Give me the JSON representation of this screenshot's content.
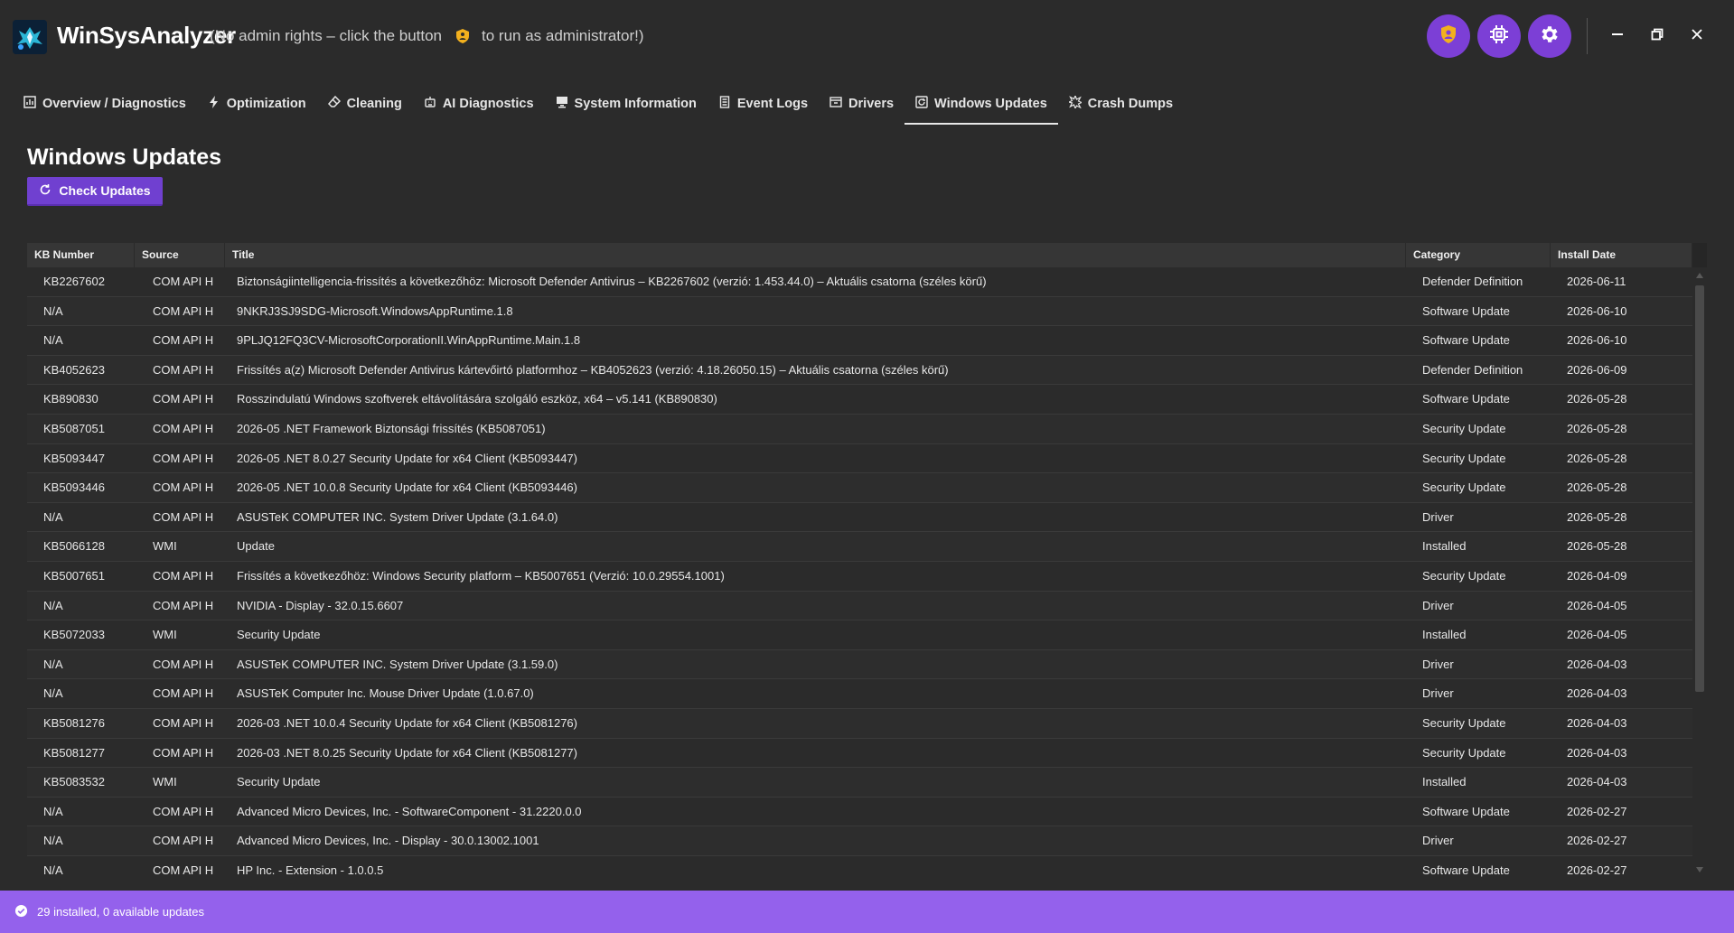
{
  "app": {
    "name": "WinSysAnalyzer",
    "admin_note_before": "(No admin rights – click the button",
    "admin_note_after": "to run as administrator!)"
  },
  "toolbar": {
    "admin_button_icon": "shield-icon",
    "chip_button_icon": "cpu-chip-icon",
    "settings_button_icon": "gear-icon",
    "accent_color": "#7c3fd6"
  },
  "tabs": [
    {
      "label": "Overview / Diagnostics",
      "icon": "bar-chart-icon"
    },
    {
      "label": "Optimization",
      "icon": "lightning-icon"
    },
    {
      "label": "Cleaning",
      "icon": "eraser-icon"
    },
    {
      "label": "AI Diagnostics",
      "icon": "robot-icon"
    },
    {
      "label": "System Information",
      "icon": "monitor-icon"
    },
    {
      "label": "Event Logs",
      "icon": "document-icon"
    },
    {
      "label": "Drivers",
      "icon": "package-icon"
    },
    {
      "label": "Windows Updates",
      "icon": "update-icon",
      "active": true
    },
    {
      "label": "Crash Dumps",
      "icon": "burst-icon"
    }
  ],
  "page": {
    "title": "Windows Updates",
    "check_button_label": "Check Updates"
  },
  "table": {
    "columns": [
      "KB Number",
      "Source",
      "Title",
      "Category",
      "Install Date"
    ],
    "rows": [
      [
        "KB2267602",
        "COM API H",
        "Biztonságiintelligencia-frissítés a következőhöz: Microsoft Defender Antivirus – KB2267602 (verzió: 1.453.44.0) – Aktuális csatorna (széles körű)",
        "Defender Definition",
        "2026-06-11"
      ],
      [
        "N/A",
        "COM API H",
        "9NKRJ3SJ9SDG-Microsoft.WindowsAppRuntime.1.8",
        "Software Update",
        "2026-06-10"
      ],
      [
        "N/A",
        "COM API H",
        "9PLJQ12FQ3CV-MicrosoftCorporationII.WinAppRuntime.Main.1.8",
        "Software Update",
        "2026-06-10"
      ],
      [
        "KB4052623",
        "COM API H",
        "Frissítés a(z) Microsoft Defender Antivirus kártevőirtó platformhoz – KB4052623 (verzió: 4.18.26050.15) – Aktuális csatorna (széles körű)",
        "Defender Definition",
        "2026-06-09"
      ],
      [
        "KB890830",
        "COM API H",
        "Rosszindulatú Windows szoftverek eltávolítására szolgáló eszköz, x64 – v5.141 (KB890830)",
        "Software Update",
        "2026-05-28"
      ],
      [
        "KB5087051",
        "COM API H",
        "2026-05 .NET Framework Biztonsági frissítés (KB5087051)",
        "Security Update",
        "2026-05-28"
      ],
      [
        "KB5093447",
        "COM API H",
        "2026-05 .NET 8.0.27 Security Update for x64 Client (KB5093447)",
        "Security Update",
        "2026-05-28"
      ],
      [
        "KB5093446",
        "COM API H",
        "2026-05 .NET 10.0.8 Security Update for x64 Client (KB5093446)",
        "Security Update",
        "2026-05-28"
      ],
      [
        "N/A",
        "COM API H",
        "ASUSTeK COMPUTER INC. System Driver Update (3.1.64.0)",
        "Driver",
        "2026-05-28"
      ],
      [
        "KB5066128",
        "WMI",
        "Update",
        "Installed",
        "2026-05-28"
      ],
      [
        "KB5007651",
        "COM API H",
        "Frissítés a következőhöz: Windows Security platform – KB5007651 (Verzió: 10.0.29554.1001)",
        "Security Update",
        "2026-04-09"
      ],
      [
        "N/A",
        "COM API H",
        "NVIDIA - Display - 32.0.15.6607",
        "Driver",
        "2026-04-05"
      ],
      [
        "KB5072033",
        "WMI",
        "Security Update",
        "Installed",
        "2026-04-05"
      ],
      [
        "N/A",
        "COM API H",
        "ASUSTeK COMPUTER INC. System Driver Update (3.1.59.0)",
        "Driver",
        "2026-04-03"
      ],
      [
        "N/A",
        "COM API H",
        "ASUSTeK Computer Inc. Mouse Driver Update (1.0.67.0)",
        "Driver",
        "2026-04-03"
      ],
      [
        "KB5081276",
        "COM API H",
        "2026-03 .NET 10.0.4 Security Update for x64 Client (KB5081276)",
        "Security Update",
        "2026-04-03"
      ],
      [
        "KB5081277",
        "COM API H",
        "2026-03 .NET 8.0.25 Security Update for x64 Client (KB5081277)",
        "Security Update",
        "2026-04-03"
      ],
      [
        "KB5083532",
        "WMI",
        "Security Update",
        "Installed",
        "2026-04-03"
      ],
      [
        "N/A",
        "COM API H",
        "Advanced Micro Devices, Inc. - SoftwareComponent - 31.2220.0.0",
        "Software Update",
        "2026-02-27"
      ],
      [
        "N/A",
        "COM API H",
        "Advanced Micro Devices, Inc. - Display - 30.0.13002.1001",
        "Driver",
        "2026-02-27"
      ],
      [
        "N/A",
        "COM API H",
        "HP Inc. - Extension - 1.0.0.5",
        "Software Update",
        "2026-02-27"
      ]
    ]
  },
  "status": {
    "text": "29 installed, 0 available updates",
    "icon": "check-circle-icon",
    "color": "#9461ec"
  }
}
